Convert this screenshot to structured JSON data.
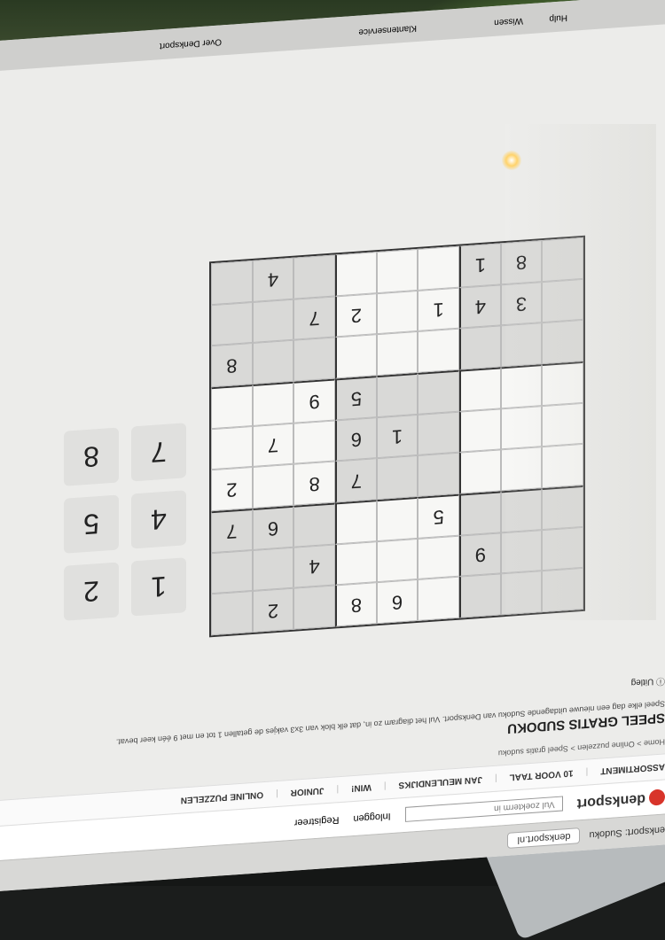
{
  "browser": {
    "url": "denksport.nl",
    "tab_label": "Denksport: Sudoku",
    "search_placeholder": "Vul zoekterm in",
    "login": "Inloggen",
    "register": "Registreer"
  },
  "site": {
    "logo": "denksport",
    "nav": [
      "ASSORTIMENT",
      "10 VOOR TAAL",
      "JAN MEULENDIJKS",
      "WIN!",
      "JUNIOR",
      "ONLINE PUZZELEN"
    ]
  },
  "breadcrumb": "Home > Online puzzelen > Speel gratis sudoku",
  "page": {
    "title": "SPEEL GRATIS SUDOKU",
    "intro": "Speel elke dag een nieuwe uitdagende Sudoku van Denksport. Vul het diagram zo in, dat elk blok van 3x3 vakjes de getallen 1 tot en met 9 één keer bevat.",
    "uitleg": "Uitleg"
  },
  "sudoku": {
    "rows": [
      [
        "",
        "",
        "",
        "",
        "6",
        "8",
        "",
        "2",
        ""
      ],
      [
        "",
        "",
        "9",
        "",
        "",
        "",
        "4",
        "",
        ""
      ],
      [
        "",
        "",
        "",
        "5",
        "",
        "",
        "",
        "6",
        "7"
      ],
      [
        "",
        "",
        "",
        "",
        "",
        "7",
        "8",
        "",
        "2"
      ],
      [
        "",
        "",
        "",
        "",
        "1",
        "6",
        "",
        "7",
        ""
      ],
      [
        "",
        "",
        "",
        "",
        "",
        "5",
        "9",
        "",
        ""
      ],
      [
        "",
        "",
        "",
        "",
        "",
        "",
        "",
        "",
        "8"
      ],
      [
        "",
        "3",
        "4",
        "1",
        "",
        "2",
        "7",
        "",
        ""
      ],
      [
        "",
        "8",
        "1",
        "",
        "",
        "",
        "",
        "4",
        ""
      ]
    ]
  },
  "numpad": [
    "1",
    "2",
    "4",
    "5",
    "7",
    "8"
  ],
  "dock": {
    "labels": [
      "Klantenservice",
      "Over Denksport",
      "Wissen",
      "Hulp"
    ]
  }
}
